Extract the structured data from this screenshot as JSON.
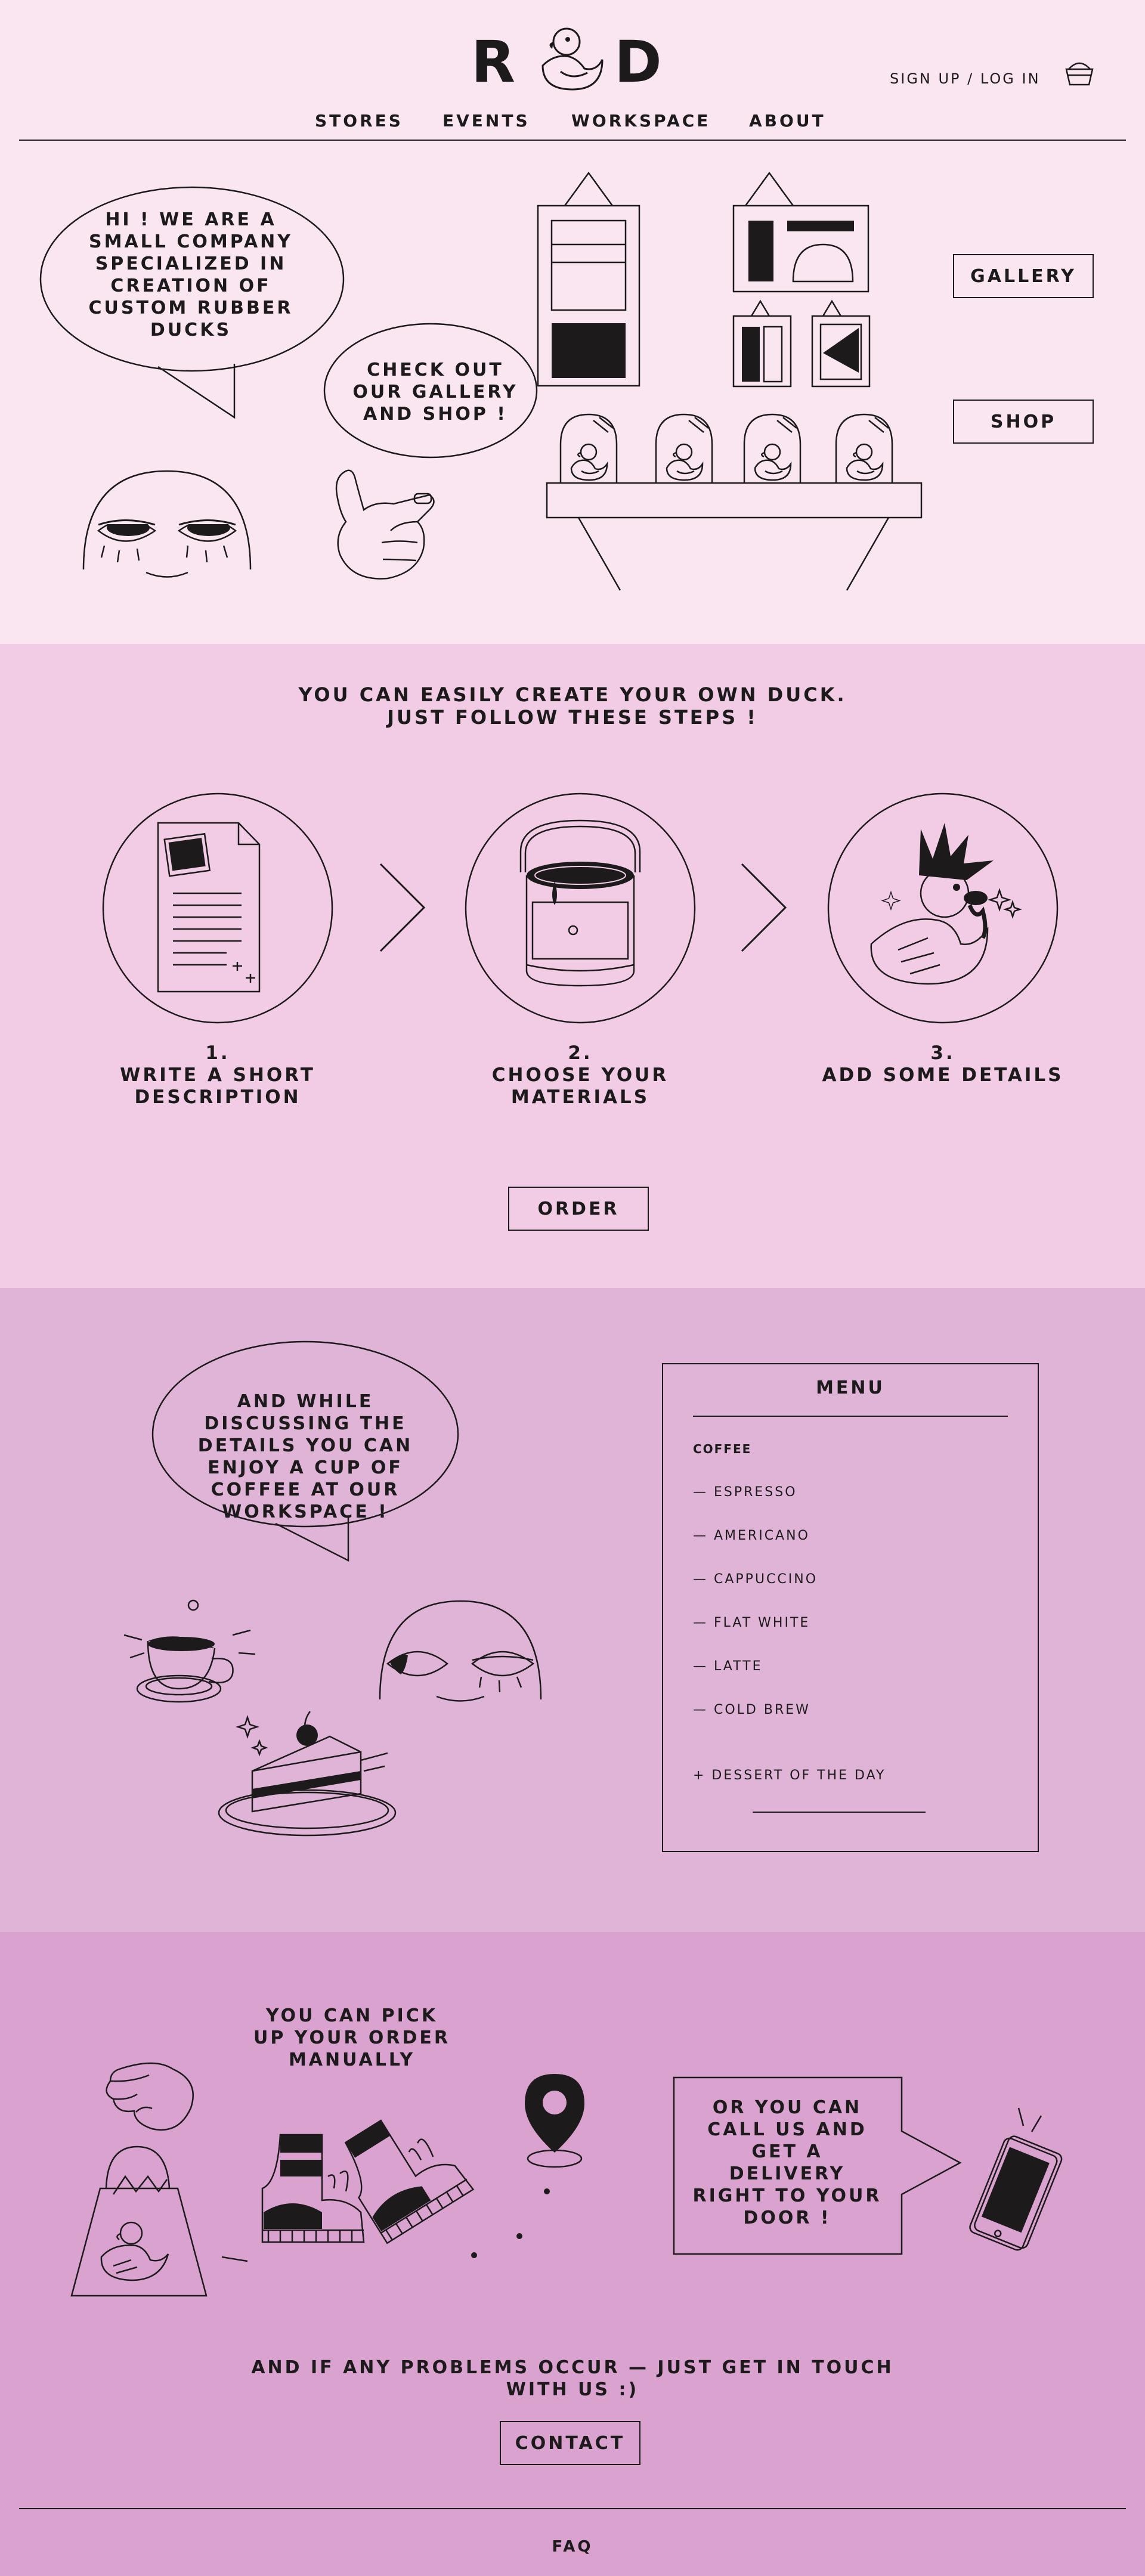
{
  "header": {
    "logo_left": "R",
    "logo_right": "D",
    "account": "SIGN UP / LOG IN",
    "nav": [
      "STORES",
      "EVENTS",
      "WORKSPACE",
      "ABOUT"
    ]
  },
  "hero": {
    "bubble1": [
      "HI ! WE ARE A",
      "SMALL COMPANY",
      "SPECIALIZED IN",
      "CREATION OF",
      "CUSTOM RUBBER",
      "DUCKS"
    ],
    "bubble2": [
      "CHECK OUT",
      "OUR GALLERY",
      "AND SHOP !"
    ],
    "gallery_btn": "GALLERY",
    "shop_btn": "SHOP"
  },
  "steps": {
    "heading": [
      "YOU CAN EASILY CREATE YOUR OWN DUCK.",
      "JUST FOLLOW THESE STEPS !"
    ],
    "items": [
      {
        "num": "1.",
        "label": [
          "WRITE A SHORT",
          "DESCRIPTION"
        ]
      },
      {
        "num": "2.",
        "label": [
          "CHOOSE YOUR",
          "MATERIALS"
        ]
      },
      {
        "num": "3.",
        "label": [
          "ADD SOME DETAILS"
        ]
      }
    ],
    "order_btn": "ORDER"
  },
  "workspace": {
    "bubble": [
      "AND WHILE",
      "DISCUSSING THE",
      "DETAILS YOU CAN",
      "ENJOY A CUP OF",
      "COFFEE AT OUR",
      "WORKSPACE !"
    ],
    "menu": {
      "title": "MENU",
      "category": "COFFEE",
      "items": [
        "— ESPRESSO",
        "— AMERICANO",
        "— CAPPUCCINO",
        "— FLAT WHITE",
        "— LATTE",
        "— COLD BREW"
      ],
      "extra": "+ DESSERT OF THE DAY"
    }
  },
  "delivery": {
    "pickup": [
      "YOU CAN PICK",
      "UP YOUR ORDER",
      "MANUALLY"
    ],
    "call": [
      "OR YOU  CAN",
      "CALL US AND",
      "GET A",
      "DELIVERY",
      "RIGHT TO YOUR",
      "DOOR !"
    ],
    "problems": [
      "AND IF ANY PROBLEMS OCCUR — JUST GET IN TOUCH",
      "WITH US :)"
    ],
    "contact_btn": "CONTACT",
    "faq": "FAQ"
  },
  "colors": {
    "s1": "#fae6f0",
    "s2": "#f1cce4",
    "s3": "#e0b4d7",
    "s4": "#daa2cf",
    "ink": "#1c1a1b"
  }
}
